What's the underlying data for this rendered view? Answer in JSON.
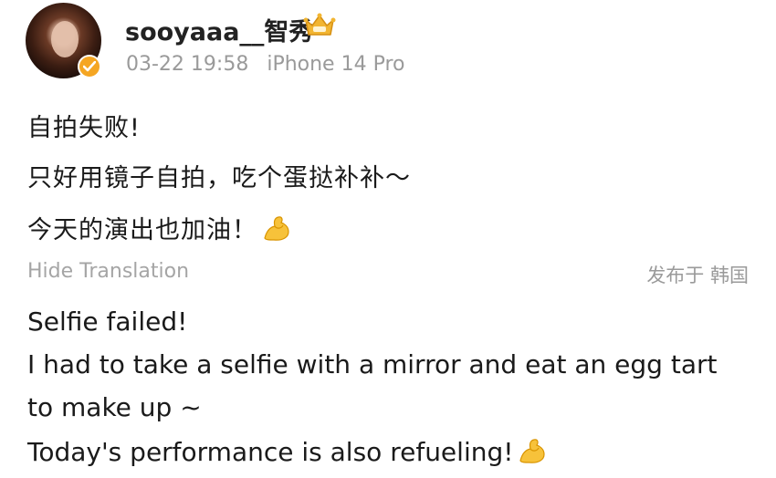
{
  "post": {
    "username": "sooyaaa__智秀",
    "timestamp": "03-22 19:58",
    "device": "iPhone 14 Pro",
    "original_lines": [
      "自拍失败!",
      "只好用镜子自拍，吃个蛋挞补补～",
      "今天的演出也加油！"
    ],
    "hide_translation_label": "Hide Translation",
    "location": "发布于 韩国",
    "translated_lines": [
      "Selfie failed!",
      "I had to take a selfie with a mirror and eat an egg tart",
      "to make up ~",
      "Today's performance is also refueling!"
    ]
  },
  "colors": {
    "text": "#1a1a1a",
    "meta": "#9a9a9a",
    "verified_badge": "#f5a623"
  },
  "icons": {
    "verified": "verified-badge-icon",
    "crown": "crown-icon",
    "flexed_biceps": "flexed-biceps-emoji"
  }
}
